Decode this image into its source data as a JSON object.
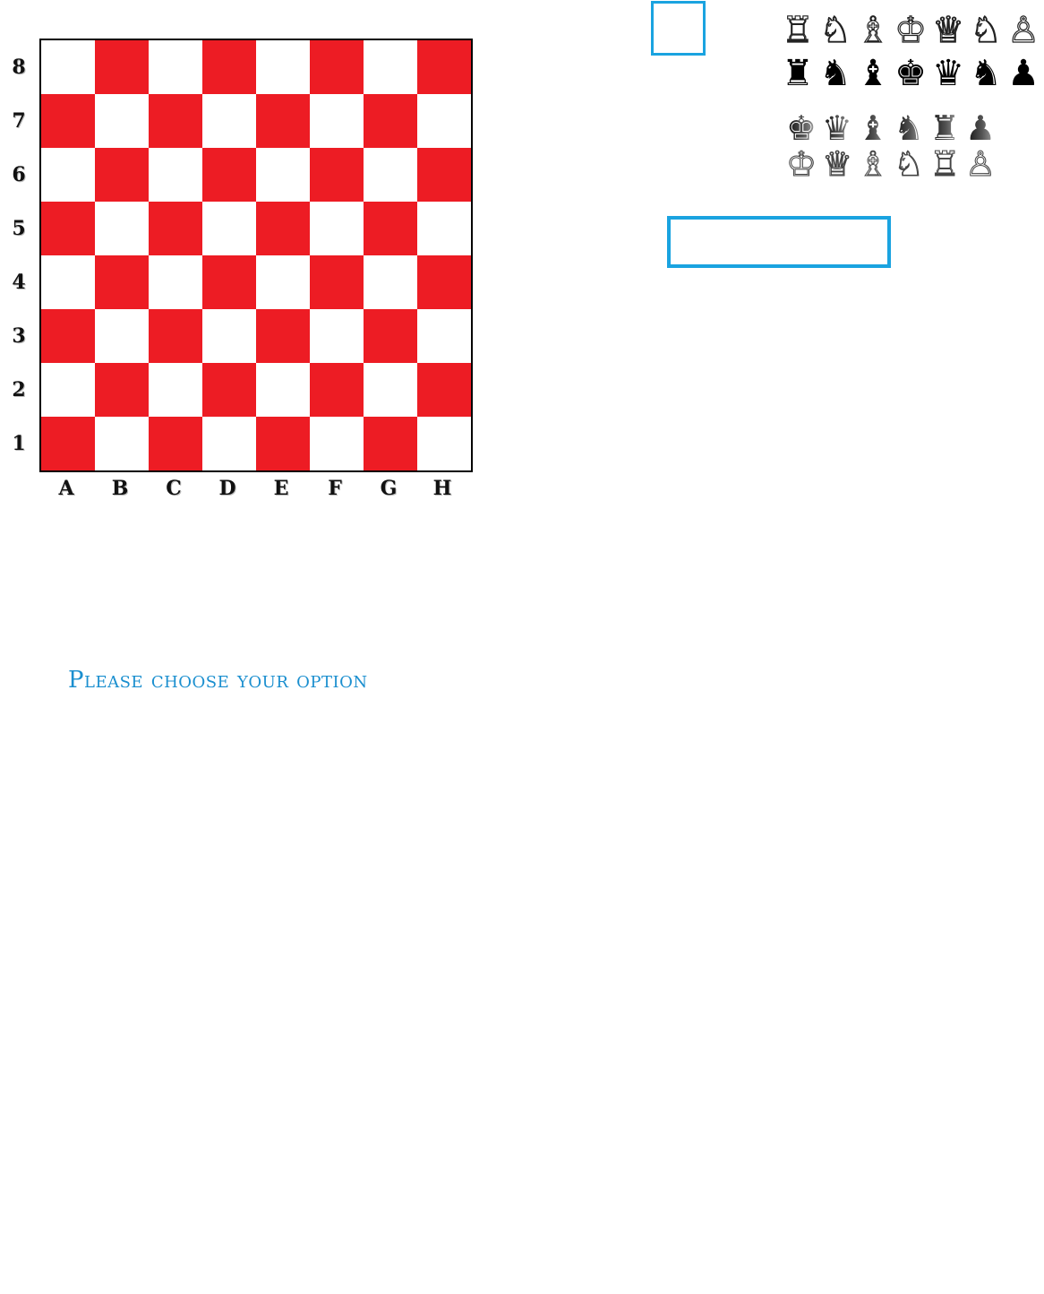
{
  "board": {
    "ranks": [
      "8",
      "7",
      "6",
      "5",
      "4",
      "3",
      "2",
      "1"
    ],
    "files": [
      "A",
      "B",
      "C",
      "D",
      "E",
      "F",
      "G",
      "H"
    ],
    "light_color": "#ffffff",
    "dark_color": "#ed1c24",
    "bottom_left_square": "dark"
  },
  "prompt": {
    "text": "Please choose your option"
  },
  "palette": {
    "row1": [
      {
        "icon": "white-rook-icon",
        "glyph": "♖"
      },
      {
        "icon": "white-knight-icon",
        "glyph": "♘"
      },
      {
        "icon": "white-bishop-icon",
        "glyph": "♗"
      },
      {
        "icon": "white-king-icon",
        "glyph": "♔"
      },
      {
        "icon": "white-queen-icon",
        "glyph": "♕"
      },
      {
        "icon": "white-knight-icon",
        "glyph": "♘"
      },
      {
        "icon": "white-pawn-icon",
        "glyph": "♙"
      }
    ],
    "row2": [
      {
        "icon": "black-rook-icon",
        "glyph": "♜"
      },
      {
        "icon": "black-knight-icon",
        "glyph": "♞"
      },
      {
        "icon": "black-bishop-icon",
        "glyph": "♝"
      },
      {
        "icon": "black-king-icon",
        "glyph": "♚"
      },
      {
        "icon": "black-queen-icon",
        "glyph": "♛"
      },
      {
        "icon": "black-knight-icon",
        "glyph": "♞"
      },
      {
        "icon": "black-pawn-icon",
        "glyph": "♟"
      }
    ],
    "row3": [
      {
        "icon": "dark-king-icon",
        "glyph": "♚"
      },
      {
        "icon": "dark-queen-icon",
        "glyph": "♛"
      },
      {
        "icon": "dark-bishop-icon",
        "glyph": "♝"
      },
      {
        "icon": "dark-knight-icon",
        "glyph": "♞"
      },
      {
        "icon": "dark-rook-icon",
        "glyph": "♜"
      },
      {
        "icon": "dark-pawn-icon",
        "glyph": "♟"
      }
    ],
    "row4": [
      {
        "icon": "light-king-icon",
        "glyph": "♔"
      },
      {
        "icon": "light-queen-icon",
        "glyph": "♕"
      },
      {
        "icon": "light-bishop-icon",
        "glyph": "♗"
      },
      {
        "icon": "light-knight-icon",
        "glyph": "♘"
      },
      {
        "icon": "light-rook-icon",
        "glyph": "♖"
      },
      {
        "icon": "light-pawn-icon",
        "glyph": "♙"
      }
    ]
  },
  "text_box": {
    "value": ""
  },
  "accent_color": "#1aa3e0"
}
